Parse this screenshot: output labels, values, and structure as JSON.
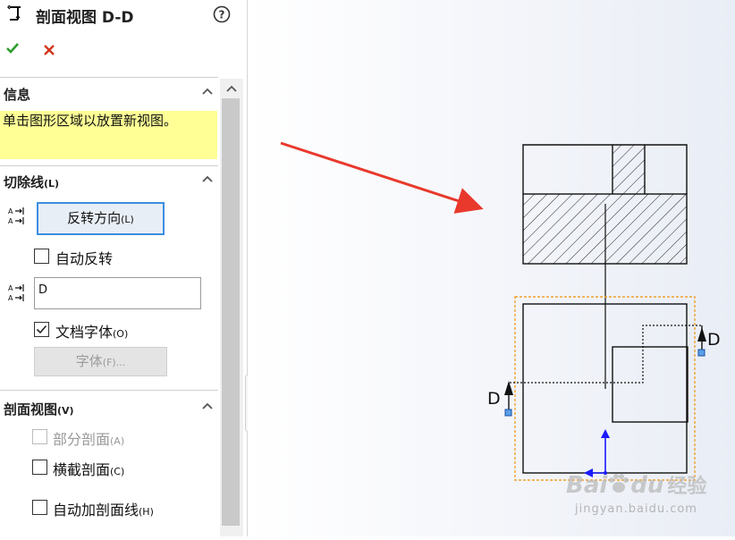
{
  "header": {
    "title": "剖面视图 D-D",
    "help_icon": "question-circle-icon"
  },
  "actions": {
    "ok_icon": "checkmark-icon",
    "cancel_icon": "x-icon",
    "ok_color": "#2e9e2e",
    "cancel_color": "#d2351e"
  },
  "info": {
    "label": "信息",
    "message": "单击图形区域以放置新视图。"
  },
  "cutting_line": {
    "label": "切除线",
    "hotkey": "(L)",
    "flip_button": {
      "label": "反转方向",
      "hotkey": "(L)"
    },
    "auto_flip": {
      "label": "自动反转",
      "checked": false
    },
    "label_value": "D",
    "doc_font": {
      "label": "文档字体",
      "hotkey": "(O)",
      "checked": true
    },
    "font_button": {
      "label": "字体",
      "hotkey": "(F)..."
    }
  },
  "section_view": {
    "label": "剖面视图",
    "hotkey": "(V)",
    "partial": {
      "label": "部分剖面",
      "hotkey": "(A)",
      "checked": false,
      "disabled": true
    },
    "slice": {
      "label": "横截剖面",
      "hotkey": "(C)",
      "checked": false
    },
    "auto_hatch": {
      "label": "自动加剖面线",
      "hotkey": "(H)",
      "checked": false
    }
  },
  "drawing": {
    "label_left": "D",
    "label_right": "D",
    "accent": "#e8392c",
    "selection_color": "#f0a030",
    "axis_color": "#1a1aff"
  },
  "watermark": {
    "brand_left": "Bai",
    "brand_right": "du",
    "brand_cn": "经验",
    "url": "jingyan.baidu.com"
  }
}
